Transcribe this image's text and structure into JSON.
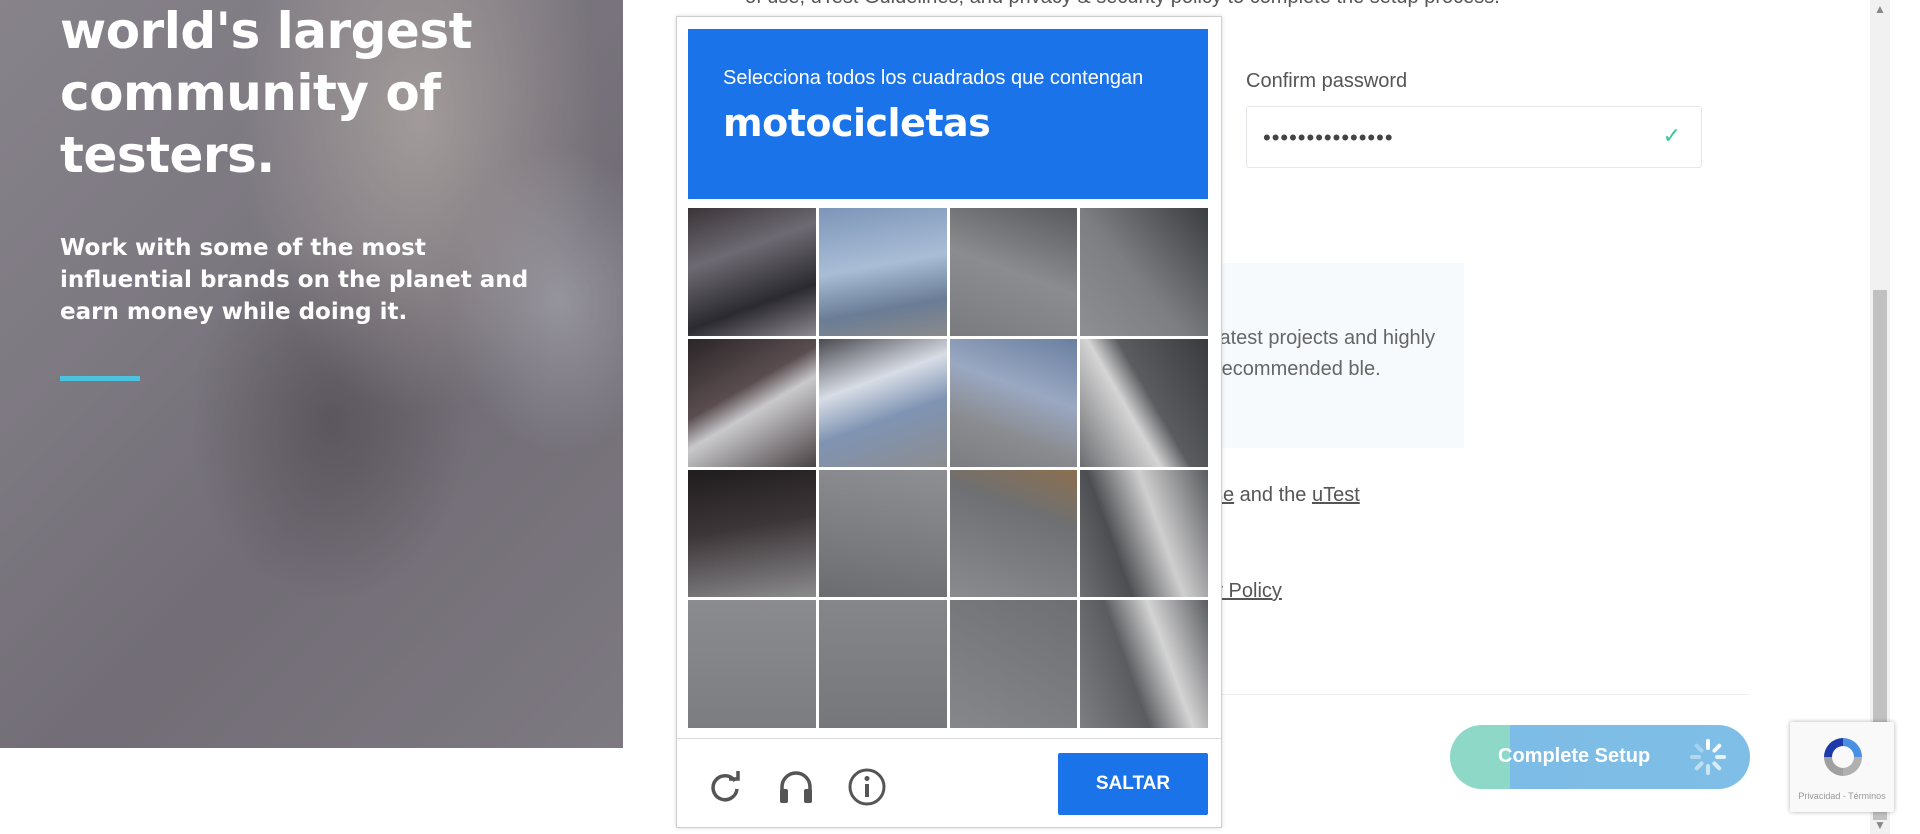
{
  "hero": {
    "title_lines": [
      "world's largest",
      "community of",
      "testers."
    ],
    "subtitle": "Work with some of the most influential brands on the planet and earn money while doing it."
  },
  "form": {
    "top_text": "of use, uTest Guidelines, and privacy & security policy to complete the setup process.",
    "confirm_password_label": "Confirm password",
    "confirm_password_value": "•••••••••••••••",
    "info_text": "latest projects and highly recommended ble.",
    "terms_line1": {
      "a": "se",
      "b": " and the ",
      "c": "uTest"
    },
    "terms_line2": "y Policy",
    "complete_button": "Complete Setup"
  },
  "captcha": {
    "instruction": "Selecciona todos los cuadrados que contengan",
    "target": "motocicletas",
    "skip_button": "SALTAR",
    "icons": [
      "reload-icon",
      "audio-icon",
      "info-icon"
    ]
  },
  "recaptcha_badge": {
    "links": "Privacidad - Términos"
  },
  "colors": {
    "captcha_blue": "#1a73e8",
    "accent_teal": "#4cc3de",
    "check_green": "#3cc69a"
  }
}
